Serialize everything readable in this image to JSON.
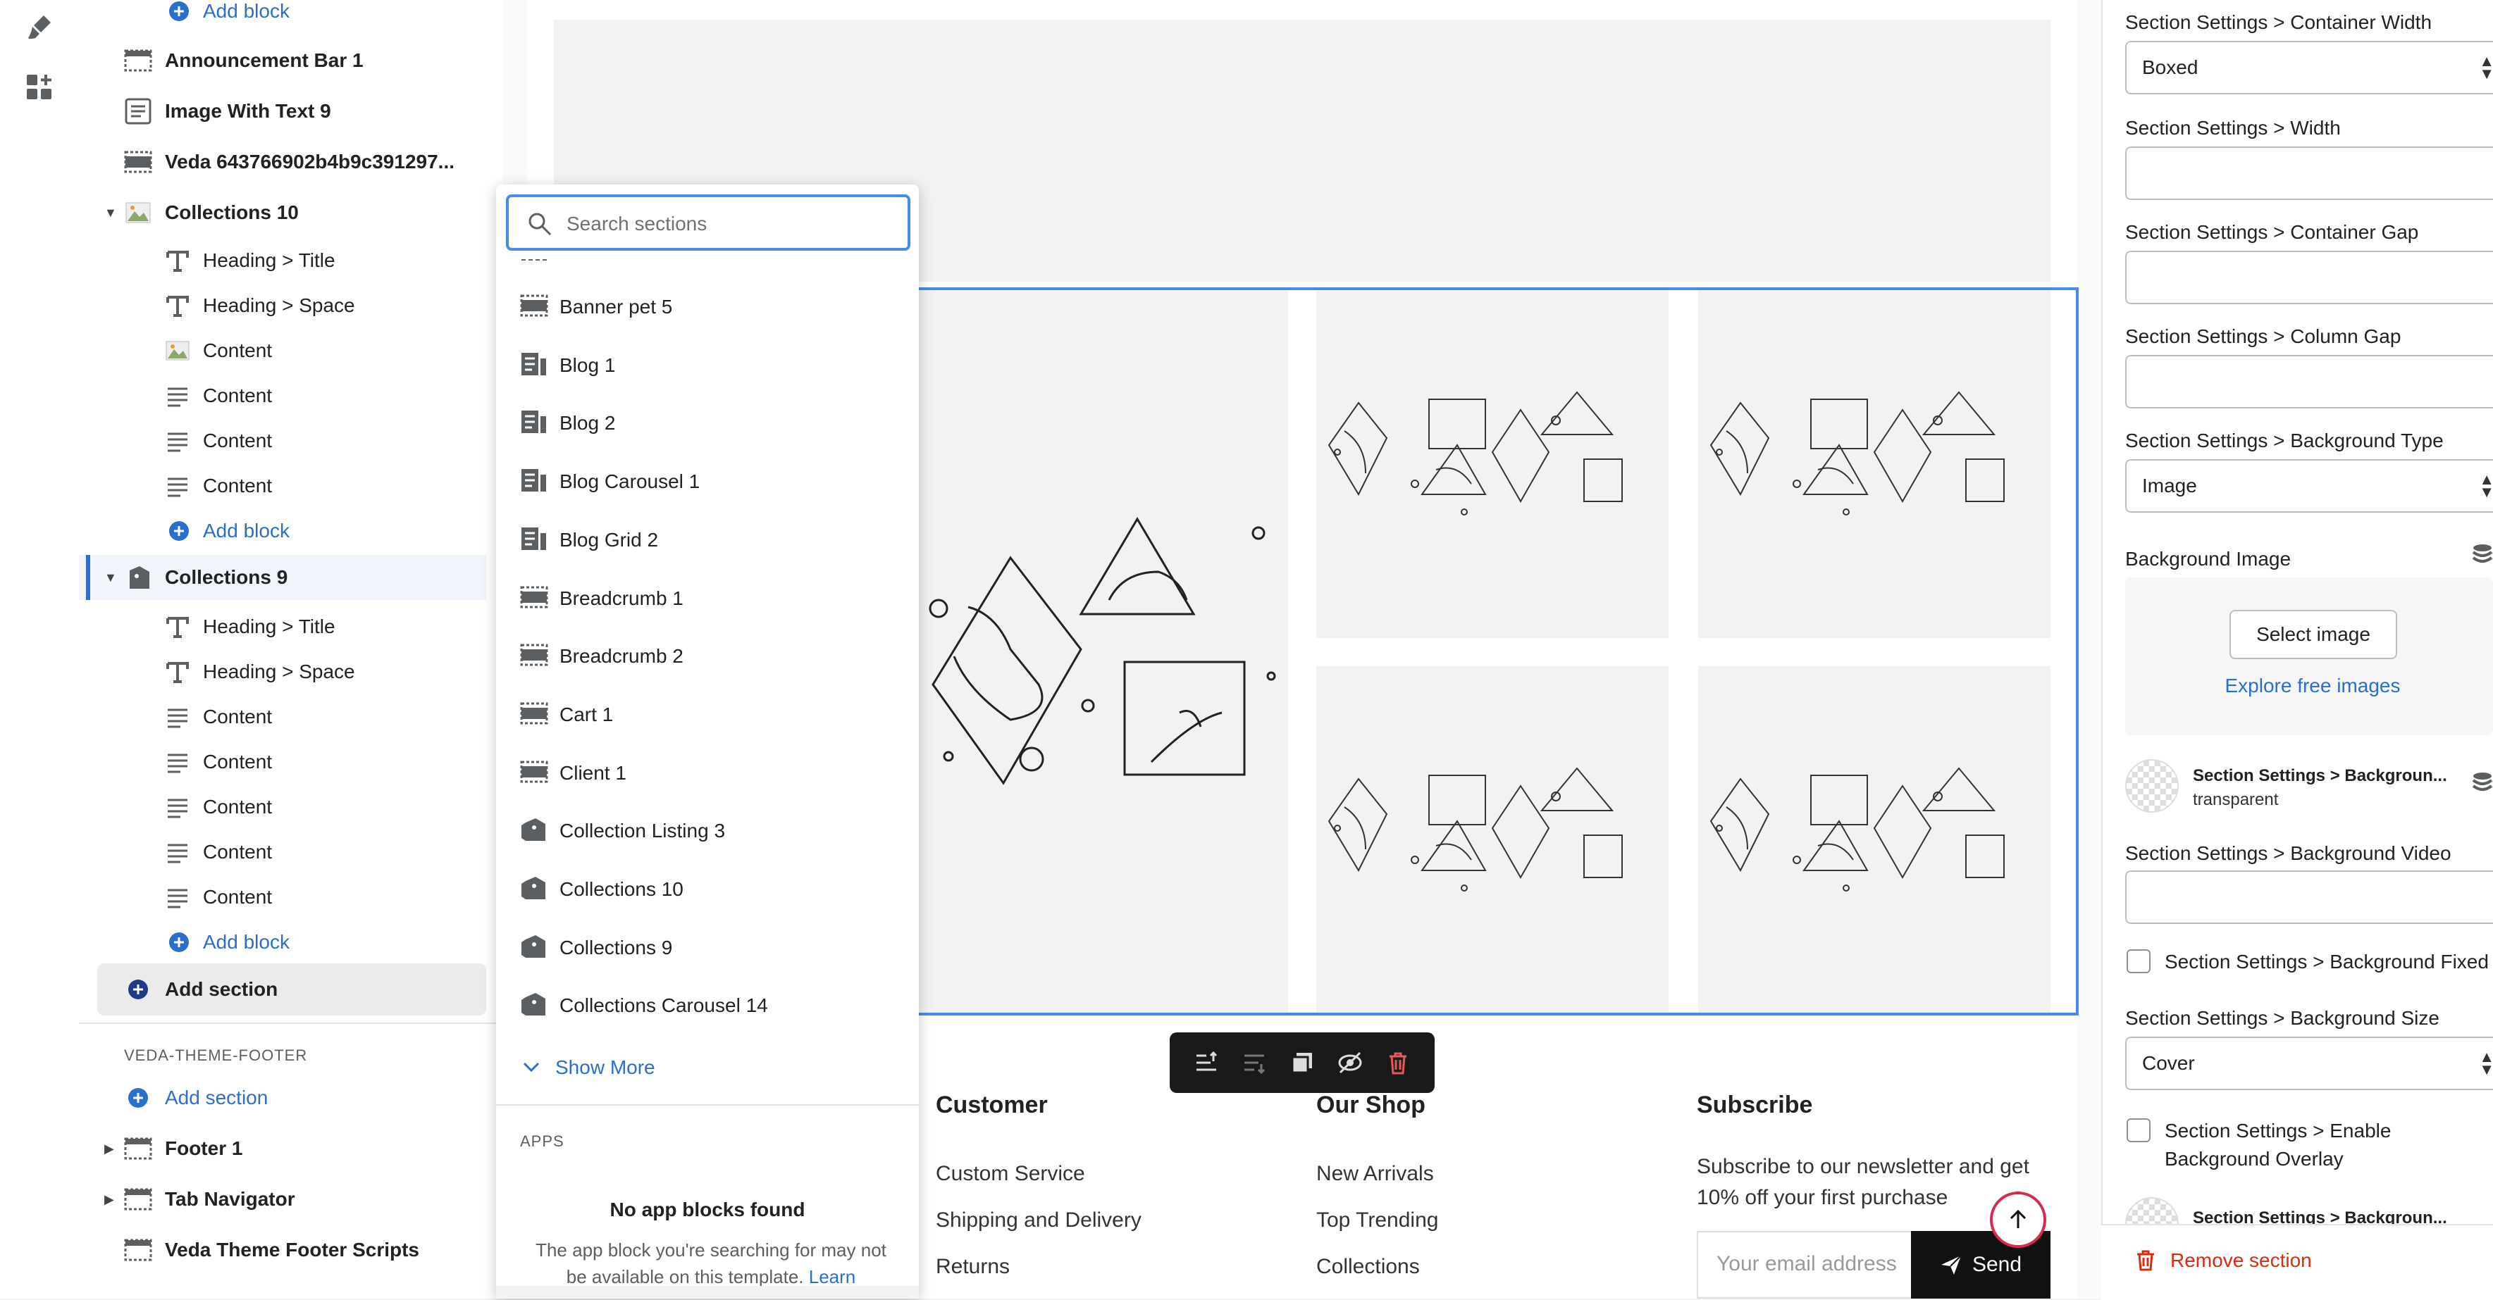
{
  "layers": {
    "top_add_block": "Add block",
    "items": [
      {
        "label": "Announcement Bar 1",
        "icon": "section-icon"
      },
      {
        "label": "Image With Text 9",
        "icon": "text-block-icon"
      },
      {
        "label": "Veda 643766902b4b9c391297...",
        "icon": "section-icon"
      },
      {
        "label": "Collections 10",
        "icon": "image-icon"
      }
    ],
    "collections10_children": [
      "Heading > Title",
      "Heading > Space",
      "Content",
      "Content",
      "Content",
      "Content"
    ],
    "add_block_1": "Add block",
    "collections9": "Collections 9",
    "collections9_children": [
      "Heading > Title",
      "Heading > Space",
      "Content",
      "Content",
      "Content",
      "Content",
      "Content"
    ],
    "add_block_2": "Add block",
    "add_section": "Add section",
    "footer_group_title": "VEDA-THEME-FOOTER",
    "footer_add_section": "Add section",
    "footer_items": [
      "Footer 1",
      "Tab Navigator",
      "Veda Theme Footer Scripts"
    ]
  },
  "picker": {
    "search_placeholder": "Search sections",
    "items": [
      {
        "label": "Banner pet 5",
        "icon": "section-icon"
      },
      {
        "label": "Blog 1",
        "icon": "blog-icon"
      },
      {
        "label": "Blog 2",
        "icon": "blog-icon"
      },
      {
        "label": "Blog Carousel 1",
        "icon": "blog-icon"
      },
      {
        "label": "Blog Grid 2",
        "icon": "blog-icon"
      },
      {
        "label": "Breadcrumb 1",
        "icon": "section-icon"
      },
      {
        "label": "Breadcrumb 2",
        "icon": "section-icon"
      },
      {
        "label": "Cart 1",
        "icon": "section-icon"
      },
      {
        "label": "Client 1",
        "icon": "section-icon"
      },
      {
        "label": "Collection Listing 3",
        "icon": "collection-icon"
      },
      {
        "label": "Collections 10",
        "icon": "collection-icon"
      },
      {
        "label": "Collections 9",
        "icon": "collection-icon"
      },
      {
        "label": "Collections Carousel 14",
        "icon": "collection-icon"
      }
    ],
    "show_more": "Show More",
    "apps_title": "APPS",
    "no_app_title": "No app blocks found",
    "no_app_desc": "The app block you're searching for may not be available on this template.",
    "learn": "Learn"
  },
  "footer": {
    "customer_title": "Customer",
    "customer_links": [
      "Custom Service",
      "Shipping and Delivery",
      "Returns"
    ],
    "shop_title": "Our Shop",
    "shop_links": [
      "New Arrivals",
      "Top Trending",
      "Collections"
    ],
    "subscribe_title": "Subscribe",
    "subscribe_text": "Subscribe to our newsletter and get 10% off your first purchase",
    "email_placeholder": "Your email address",
    "send_label": "Send"
  },
  "settings": {
    "container_width_label": "Section Settings > Container Width",
    "container_width_value": "Boxed",
    "width_label": "Section Settings > Width",
    "container_gap_label": "Section Settings > Container Gap",
    "column_gap_label": "Section Settings > Column Gap",
    "bg_type_label": "Section Settings > Background Type",
    "bg_type_value": "Image",
    "bg_image_label": "Background Image",
    "select_image": "Select image",
    "explore_images": "Explore free images",
    "bg_color_label": "Section Settings > Backgroun...",
    "bg_color_value": "transparent",
    "bg_video_label": "Section Settings > Background Video",
    "bg_fixed_label": "Section Settings > Background Fixed",
    "bg_size_label": "Section Settings > Background Size",
    "bg_size_value": "Cover",
    "overlay_label_1": "Section Settings > Enable",
    "overlay_label_2": "Background Overlay",
    "overlay_color_label": "Section Settings > Backgroun...",
    "remove_section": "Remove section"
  },
  "colors": {
    "accent": "#2c6ecb",
    "danger": "#d72c0d",
    "selection": "#4a8ae6"
  }
}
